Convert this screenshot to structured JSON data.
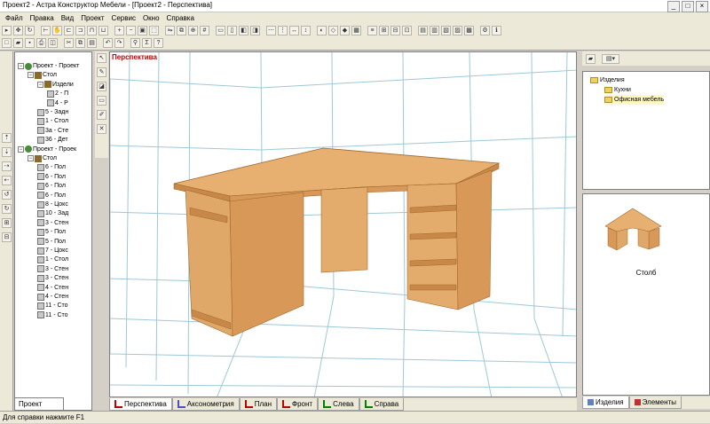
{
  "window": {
    "title": "Проект2 - Астра Конструктор Мебели - [Проект2 - Перспектива]",
    "controls": [
      "_",
      "□",
      "×"
    ]
  },
  "menu": [
    "Файл",
    "Правка",
    "Вид",
    "Проект",
    "Сервис",
    "Окно",
    "Справка"
  ],
  "tree": {
    "items": [
      {
        "level": 0,
        "exp": "−",
        "icon": "proj",
        "label": "Проект - Проект"
      },
      {
        "level": 1,
        "exp": "−",
        "icon": "table",
        "label": "Стол"
      },
      {
        "level": 2,
        "exp": "−",
        "icon": "table",
        "label": "Издели"
      },
      {
        "level": 3,
        "exp": "",
        "icon": "part",
        "label": "2 - П"
      },
      {
        "level": 3,
        "exp": "",
        "icon": "part",
        "label": "4 - Р"
      },
      {
        "level": 2,
        "exp": "",
        "icon": "part",
        "label": "5 - Задн"
      },
      {
        "level": 2,
        "exp": "",
        "icon": "part",
        "label": "1 - Стол"
      },
      {
        "level": 2,
        "exp": "",
        "icon": "part",
        "label": "3а - Сте"
      },
      {
        "level": 2,
        "exp": "",
        "icon": "part",
        "label": "36 - Дет"
      },
      {
        "level": 0,
        "exp": "−",
        "icon": "proj",
        "label": "Проект - Проек"
      },
      {
        "level": 1,
        "exp": "−",
        "icon": "table",
        "label": "Стол"
      },
      {
        "level": 2,
        "exp": "",
        "icon": "part",
        "label": "6 - Пол"
      },
      {
        "level": 2,
        "exp": "",
        "icon": "part",
        "label": "6 - Пол"
      },
      {
        "level": 2,
        "exp": "",
        "icon": "part",
        "label": "6 - Пол"
      },
      {
        "level": 2,
        "exp": "",
        "icon": "part",
        "label": "6 - Пол"
      },
      {
        "level": 2,
        "exp": "",
        "icon": "part",
        "label": "8 - Цокс"
      },
      {
        "level": 2,
        "exp": "",
        "icon": "part",
        "label": "10 - Зад"
      },
      {
        "level": 2,
        "exp": "",
        "icon": "part",
        "label": "3 - Стен"
      },
      {
        "level": 2,
        "exp": "",
        "icon": "part",
        "label": "5 - Пол"
      },
      {
        "level": 2,
        "exp": "",
        "icon": "part",
        "label": "5 - Пол"
      },
      {
        "level": 2,
        "exp": "",
        "icon": "part",
        "label": "7 - Цокс"
      },
      {
        "level": 2,
        "exp": "",
        "icon": "part",
        "label": "1 - Стол"
      },
      {
        "level": 2,
        "exp": "",
        "icon": "part",
        "label": "3 - Стен"
      },
      {
        "level": 2,
        "exp": "",
        "icon": "part",
        "label": "3 - Стен"
      },
      {
        "level": 2,
        "exp": "",
        "icon": "part",
        "label": "4 - Стен"
      },
      {
        "level": 2,
        "exp": "",
        "icon": "part",
        "label": "4 - Стен"
      },
      {
        "level": 2,
        "exp": "",
        "icon": "part",
        "label": "11 - Сто"
      },
      {
        "level": 2,
        "exp": "",
        "icon": "part",
        "label": "11 - Сто"
      }
    ],
    "tab_label": "Проект"
  },
  "viewport": {
    "label": "Перспектива"
  },
  "view_tabs": [
    {
      "label": "Перспектива",
      "color": "#c00000",
      "active": true
    },
    {
      "label": "Аксонометрия",
      "color": "#5050c0",
      "active": false
    },
    {
      "label": "План",
      "color": "#c00000",
      "active": false
    },
    {
      "label": "Фронт",
      "color": "#c00000",
      "active": false
    },
    {
      "label": "Слева",
      "color": "#008000",
      "active": false
    },
    {
      "label": "Справа",
      "color": "#008000",
      "active": false
    }
  ],
  "catalog": {
    "items": [
      {
        "label": "Изделия",
        "level": 0
      },
      {
        "label": "Кухни",
        "level": 1
      },
      {
        "label": "Офисная мебель",
        "level": 1
      }
    ],
    "preview_caption": "Столб"
  },
  "right_tabs": [
    {
      "label": "Изделия"
    },
    {
      "label": "Элементы"
    }
  ],
  "status": "Для справки нажмите F1",
  "colors": {
    "wood_light": "#e8b070",
    "wood_mid": "#d89858",
    "wood_dark": "#b87838",
    "grid": "#9ec8d8"
  }
}
